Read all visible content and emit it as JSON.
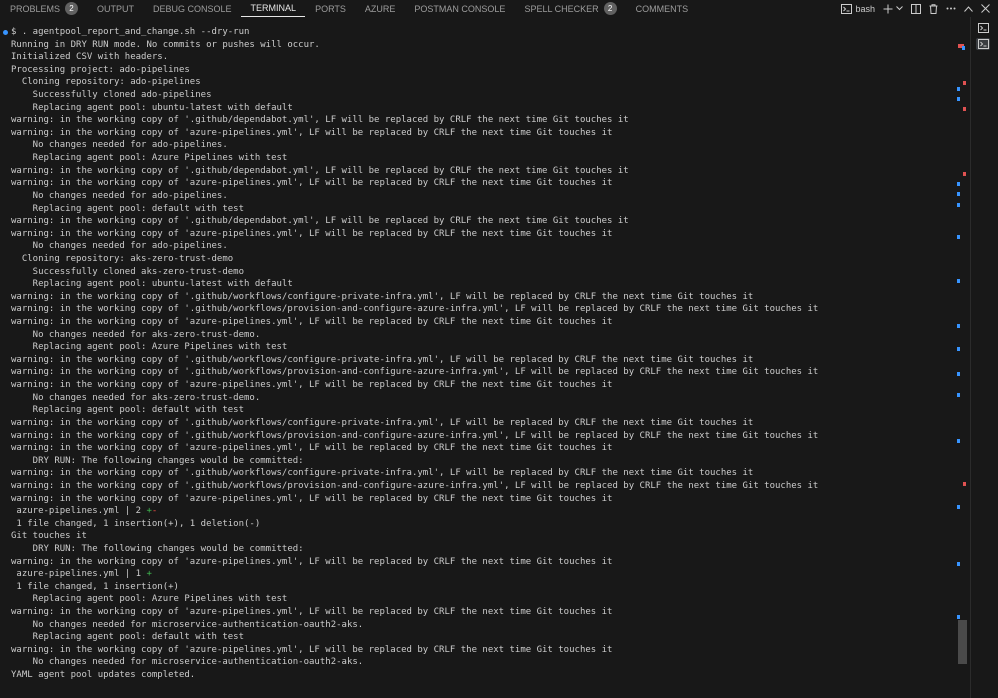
{
  "tabs": [
    {
      "label": "PROBLEMS",
      "badge": "2"
    },
    {
      "label": "OUTPUT"
    },
    {
      "label": "DEBUG CONSOLE"
    },
    {
      "label": "TERMINAL",
      "active": true
    },
    {
      "label": "PORTS"
    },
    {
      "label": "AZURE"
    },
    {
      "label": "POSTMAN CONSOLE"
    },
    {
      "label": "SPELL CHECKER",
      "badge": "2"
    },
    {
      "label": "COMMENTS"
    }
  ],
  "toolbar": {
    "shell_label": "bash",
    "icons": [
      "terminal-icon",
      "plus-icon",
      "chevron-down-icon",
      "split-terminal-icon",
      "trash-icon",
      "more-icon",
      "chevron-up-icon",
      "close-icon"
    ]
  },
  "terminal": {
    "lines": [
      "$ . agentpool_report_and_change.sh --dry-run",
      "Running in DRY RUN mode. No commits or pushes will occur.",
      "Initialized CSV with headers.",
      "Processing project: ado-pipelines",
      "  Cloning repository: ado-pipelines",
      "    Successfully cloned ado-pipelines",
      "    Replacing agent pool: ubuntu-latest with default",
      "warning: in the working copy of '.github/dependabot.yml', LF will be replaced by CRLF the next time Git touches it",
      "warning: in the working copy of 'azure-pipelines.yml', LF will be replaced by CRLF the next time Git touches it",
      "    No changes needed for ado-pipelines.",
      "    Replacing agent pool: Azure Pipelines with test",
      "warning: in the working copy of '.github/dependabot.yml', LF will be replaced by CRLF the next time Git touches it",
      "warning: in the working copy of 'azure-pipelines.yml', LF will be replaced by CRLF the next time Git touches it",
      "    No changes needed for ado-pipelines.",
      "    Replacing agent pool: default with test",
      "warning: in the working copy of '.github/dependabot.yml', LF will be replaced by CRLF the next time Git touches it",
      "warning: in the working copy of 'azure-pipelines.yml', LF will be replaced by CRLF the next time Git touches it",
      "    No changes needed for ado-pipelines.",
      "  Cloning repository: aks-zero-trust-demo",
      "    Successfully cloned aks-zero-trust-demo",
      "    Replacing agent pool: ubuntu-latest with default",
      "warning: in the working copy of '.github/workflows/configure-private-infra.yml', LF will be replaced by CRLF the next time Git touches it",
      "warning: in the working copy of '.github/workflows/provision-and-configure-azure-infra.yml', LF will be replaced by CRLF the next time Git touches it",
      "warning: in the working copy of 'azure-pipelines.yml', LF will be replaced by CRLF the next time Git touches it",
      "    No changes needed for aks-zero-trust-demo.",
      "    Replacing agent pool: Azure Pipelines with test",
      "warning: in the working copy of '.github/workflows/configure-private-infra.yml', LF will be replaced by CRLF the next time Git touches it",
      "warning: in the working copy of '.github/workflows/provision-and-configure-azure-infra.yml', LF will be replaced by CRLF the next time Git touches it",
      "warning: in the working copy of 'azure-pipelines.yml', LF will be replaced by CRLF the next time Git touches it",
      "    No changes needed for aks-zero-trust-demo.",
      "    Replacing agent pool: default with test",
      "warning: in the working copy of '.github/workflows/configure-private-infra.yml', LF will be replaced by CRLF the next time Git touches it",
      "warning: in the working copy of '.github/workflows/provision-and-configure-azure-infra.yml', LF will be replaced by CRLF the next time Git touches it",
      "warning: in the working copy of 'azure-pipelines.yml', LF will be replaced by CRLF the next time Git touches it",
      "    DRY RUN: The following changes would be committed:",
      "warning: in the working copy of '.github/workflows/configure-private-infra.yml', LF will be replaced by CRLF the next time Git touches it",
      "warning: in the working copy of '.github/workflows/provision-and-configure-azure-infra.yml', LF will be replaced by CRLF the next time Git touches it",
      "warning: in the working copy of 'azure-pipelines.yml', LF will be replaced by CRLF the next time Git touches it",
      {
        "segments": [
          {
            "text": " azure-pipelines.yml | 2 "
          },
          {
            "text": "+",
            "cls": "plus"
          },
          {
            "text": "-",
            "cls": "minus"
          }
        ]
      },
      " 1 file changed, 1 insertion(+), 1 deletion(-)",
      "Git touches it",
      "    DRY RUN: The following changes would be committed:",
      "warning: in the working copy of 'azure-pipelines.yml', LF will be replaced by CRLF the next time Git touches it",
      {
        "segments": [
          {
            "text": " azure-pipelines.yml | 1 "
          },
          {
            "text": "+",
            "cls": "plus"
          }
        ]
      },
      " 1 file changed, 1 insertion(+)",
      "    Replacing agent pool: Azure Pipelines with test",
      "warning: in the working copy of 'azure-pipelines.yml', LF will be replaced by CRLF the next time Git touches it",
      "    No changes needed for microservice-authentication-oauth2-aks.",
      "    Replacing agent pool: default with test",
      "warning: in the working copy of 'azure-pipelines.yml', LF will be replaced by CRLF the next time Git touches it",
      "    No changes needed for microservice-authentication-oauth2-aks.",
      "YAML agent pool updates completed."
    ]
  },
  "colors": {
    "background": "#181818",
    "text": "#cccccc",
    "accent_blue": "#3794ff",
    "diff_add": "#3fb950",
    "diff_del": "#f85149",
    "badge": "#616161"
  }
}
